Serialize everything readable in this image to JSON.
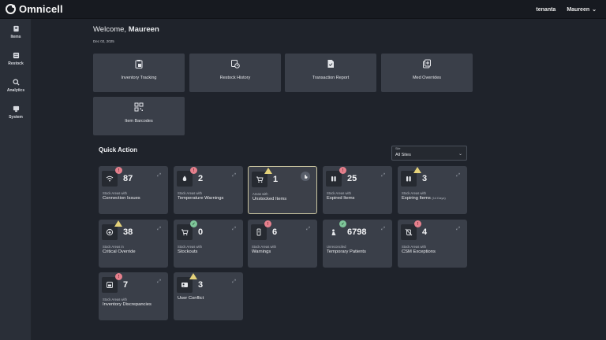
{
  "header": {
    "brand": "Omnicell",
    "tenant": "tenanta",
    "user": "Maureen",
    "user_chevron": "⌄"
  },
  "sidebar": {
    "items": [
      {
        "label": "Items",
        "icon": "box-icon"
      },
      {
        "label": "Restock",
        "icon": "restock-icon"
      },
      {
        "label": "Analytics",
        "icon": "analytics-icon"
      },
      {
        "label": "System",
        "icon": "system-icon"
      }
    ]
  },
  "welcome": {
    "prefix": "Welcome,",
    "name": "Maureen",
    "date": "Dec 02, 2025"
  },
  "tiles": [
    {
      "label": "Inventory Tracking",
      "icon": "clipboard-icon"
    },
    {
      "label": "Restock History",
      "icon": "history-icon"
    },
    {
      "label": "Transaction Report",
      "icon": "report-icon"
    },
    {
      "label": "Med Overrides",
      "icon": "med-override-icon"
    },
    {
      "label": "Item Barcodes",
      "icon": "barcode-icon"
    }
  ],
  "quick_action": {
    "title": "Quick Action",
    "site_label": "Site",
    "site_value": "All Sites",
    "site_chevron": "⌄"
  },
  "cards": [
    {
      "count": "87",
      "sub": "Stock Areas with",
      "main": "Connection Issues",
      "alert": "red",
      "icon": "wifi-icon"
    },
    {
      "count": "2",
      "sub": "Stock Areas with",
      "main": "Temperature Warnings",
      "alert": "red",
      "icon": "temperature-icon"
    },
    {
      "count": "1",
      "sub": "Areas with",
      "main": "Unstocked Items",
      "alert": "warn",
      "icon": "cart-icon"
    },
    {
      "count": "25",
      "sub": "Stock Areas with",
      "main": "Expired Items",
      "alert": "red",
      "icon": "vials-icon"
    },
    {
      "count": "3",
      "sub": "Stock Areas with",
      "main": "Expiring Items",
      "main_suffix": "(14 Days)",
      "alert": "warn",
      "icon": "vials-icon"
    },
    {
      "count": "38",
      "sub": "Stock Areas in",
      "main": "Critical Override",
      "alert": "warn",
      "icon": "override-icon"
    },
    {
      "count": "0",
      "sub": "Stock Areas with",
      "main": "Stockouts",
      "alert": "green",
      "icon": "cart-icon"
    },
    {
      "count": "6",
      "sub": "Stock Areas with",
      "main": "Warnings",
      "alert": "red",
      "icon": "phone-warning-icon"
    },
    {
      "count": "6798",
      "sub": "Unreconciled",
      "main": "Temporary Patients",
      "alert": "green",
      "icon": "patient-icon"
    },
    {
      "count": "4",
      "sub": "Stock Areas with",
      "main": "CSM Exceptions",
      "alert": "red",
      "icon": "csm-icon"
    },
    {
      "count": "7",
      "sub": "Stock Areas with",
      "main": "Inventory Discrepancies",
      "alert": "red",
      "icon": "discrepancy-icon"
    },
    {
      "count": "3",
      "sub": "",
      "main": "User Conflict",
      "alert": "warn",
      "icon": "user-conflict-icon"
    }
  ],
  "badge_marks": {
    "red": "!",
    "green": "✓"
  },
  "expand_glyph": "⤢",
  "colors": {
    "background": "#1f232b",
    "card": "#3a3f49",
    "alert_red": "#e5808d",
    "alert_warn": "#e5d27a",
    "alert_green": "#7fc59a"
  }
}
